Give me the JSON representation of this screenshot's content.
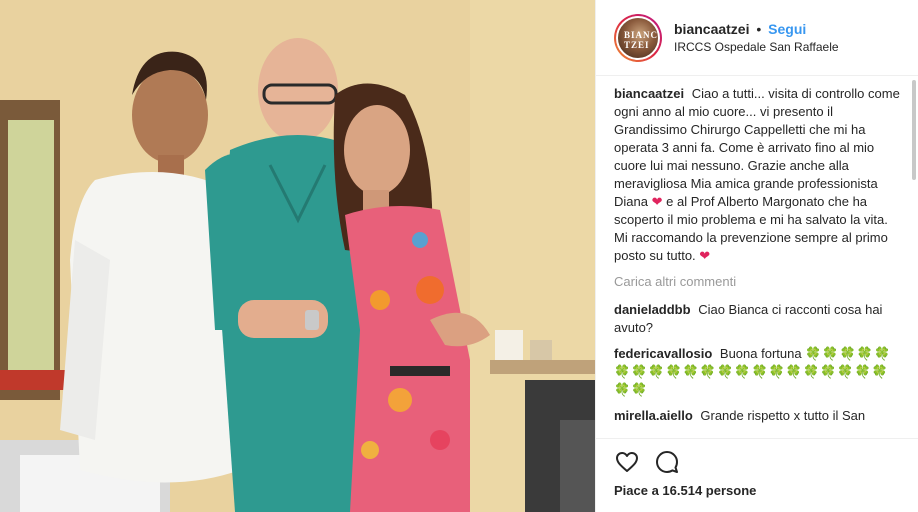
{
  "header": {
    "username": "biancaatzei",
    "separator": "•",
    "follow_label": "Segui",
    "location": "IRCCS Ospedale San Raffaele",
    "avatar_text": "BIANCA TZEI"
  },
  "caption": {
    "username": "biancaatzei",
    "lines": [
      "Ciao a tutti... visita di controllo come ogni anno al mio cuore... vi presento il Grandissimo Chirurgo Cappelletti che mi ha operata 3 anni fa. Come è arrivato fino al mio cuore lui mai nessuno. Grazie anche alla meravigliosa Mia amica grande professionista Diana",
      "e al Prof Alberto Margonato che ha scoperto il mio problema e mi ha salvato la vita.",
      "Mi raccomando la prevenzione sempre al primo posto su tutto."
    ],
    "heart": "❤"
  },
  "load_more_label": "Carica altri commenti",
  "comments": [
    {
      "user": "danieladdbb",
      "text": "Ciao Bianca ci racconti cosa hai avuto?"
    },
    {
      "user": "federicavallosio",
      "text": "Buona fortuna",
      "emoji": "🍀🍀🍀🍀🍀🍀🍀🍀🍀🍀🍀🍀🍀🍀🍀🍀🍀🍀🍀🍀🍀🍀🍀"
    },
    {
      "user": "mirella.aiello",
      "text": "Grande rispetto x tutto il San"
    }
  ],
  "footer": {
    "likes_label": "Piace a 16.514 persone",
    "like_icon": "heart-outline-icon",
    "comment_icon": "comment-bubble-icon"
  },
  "colors": {
    "link": "#3897f0",
    "heart": "#e0245e",
    "clover": "#1f8a3a"
  }
}
